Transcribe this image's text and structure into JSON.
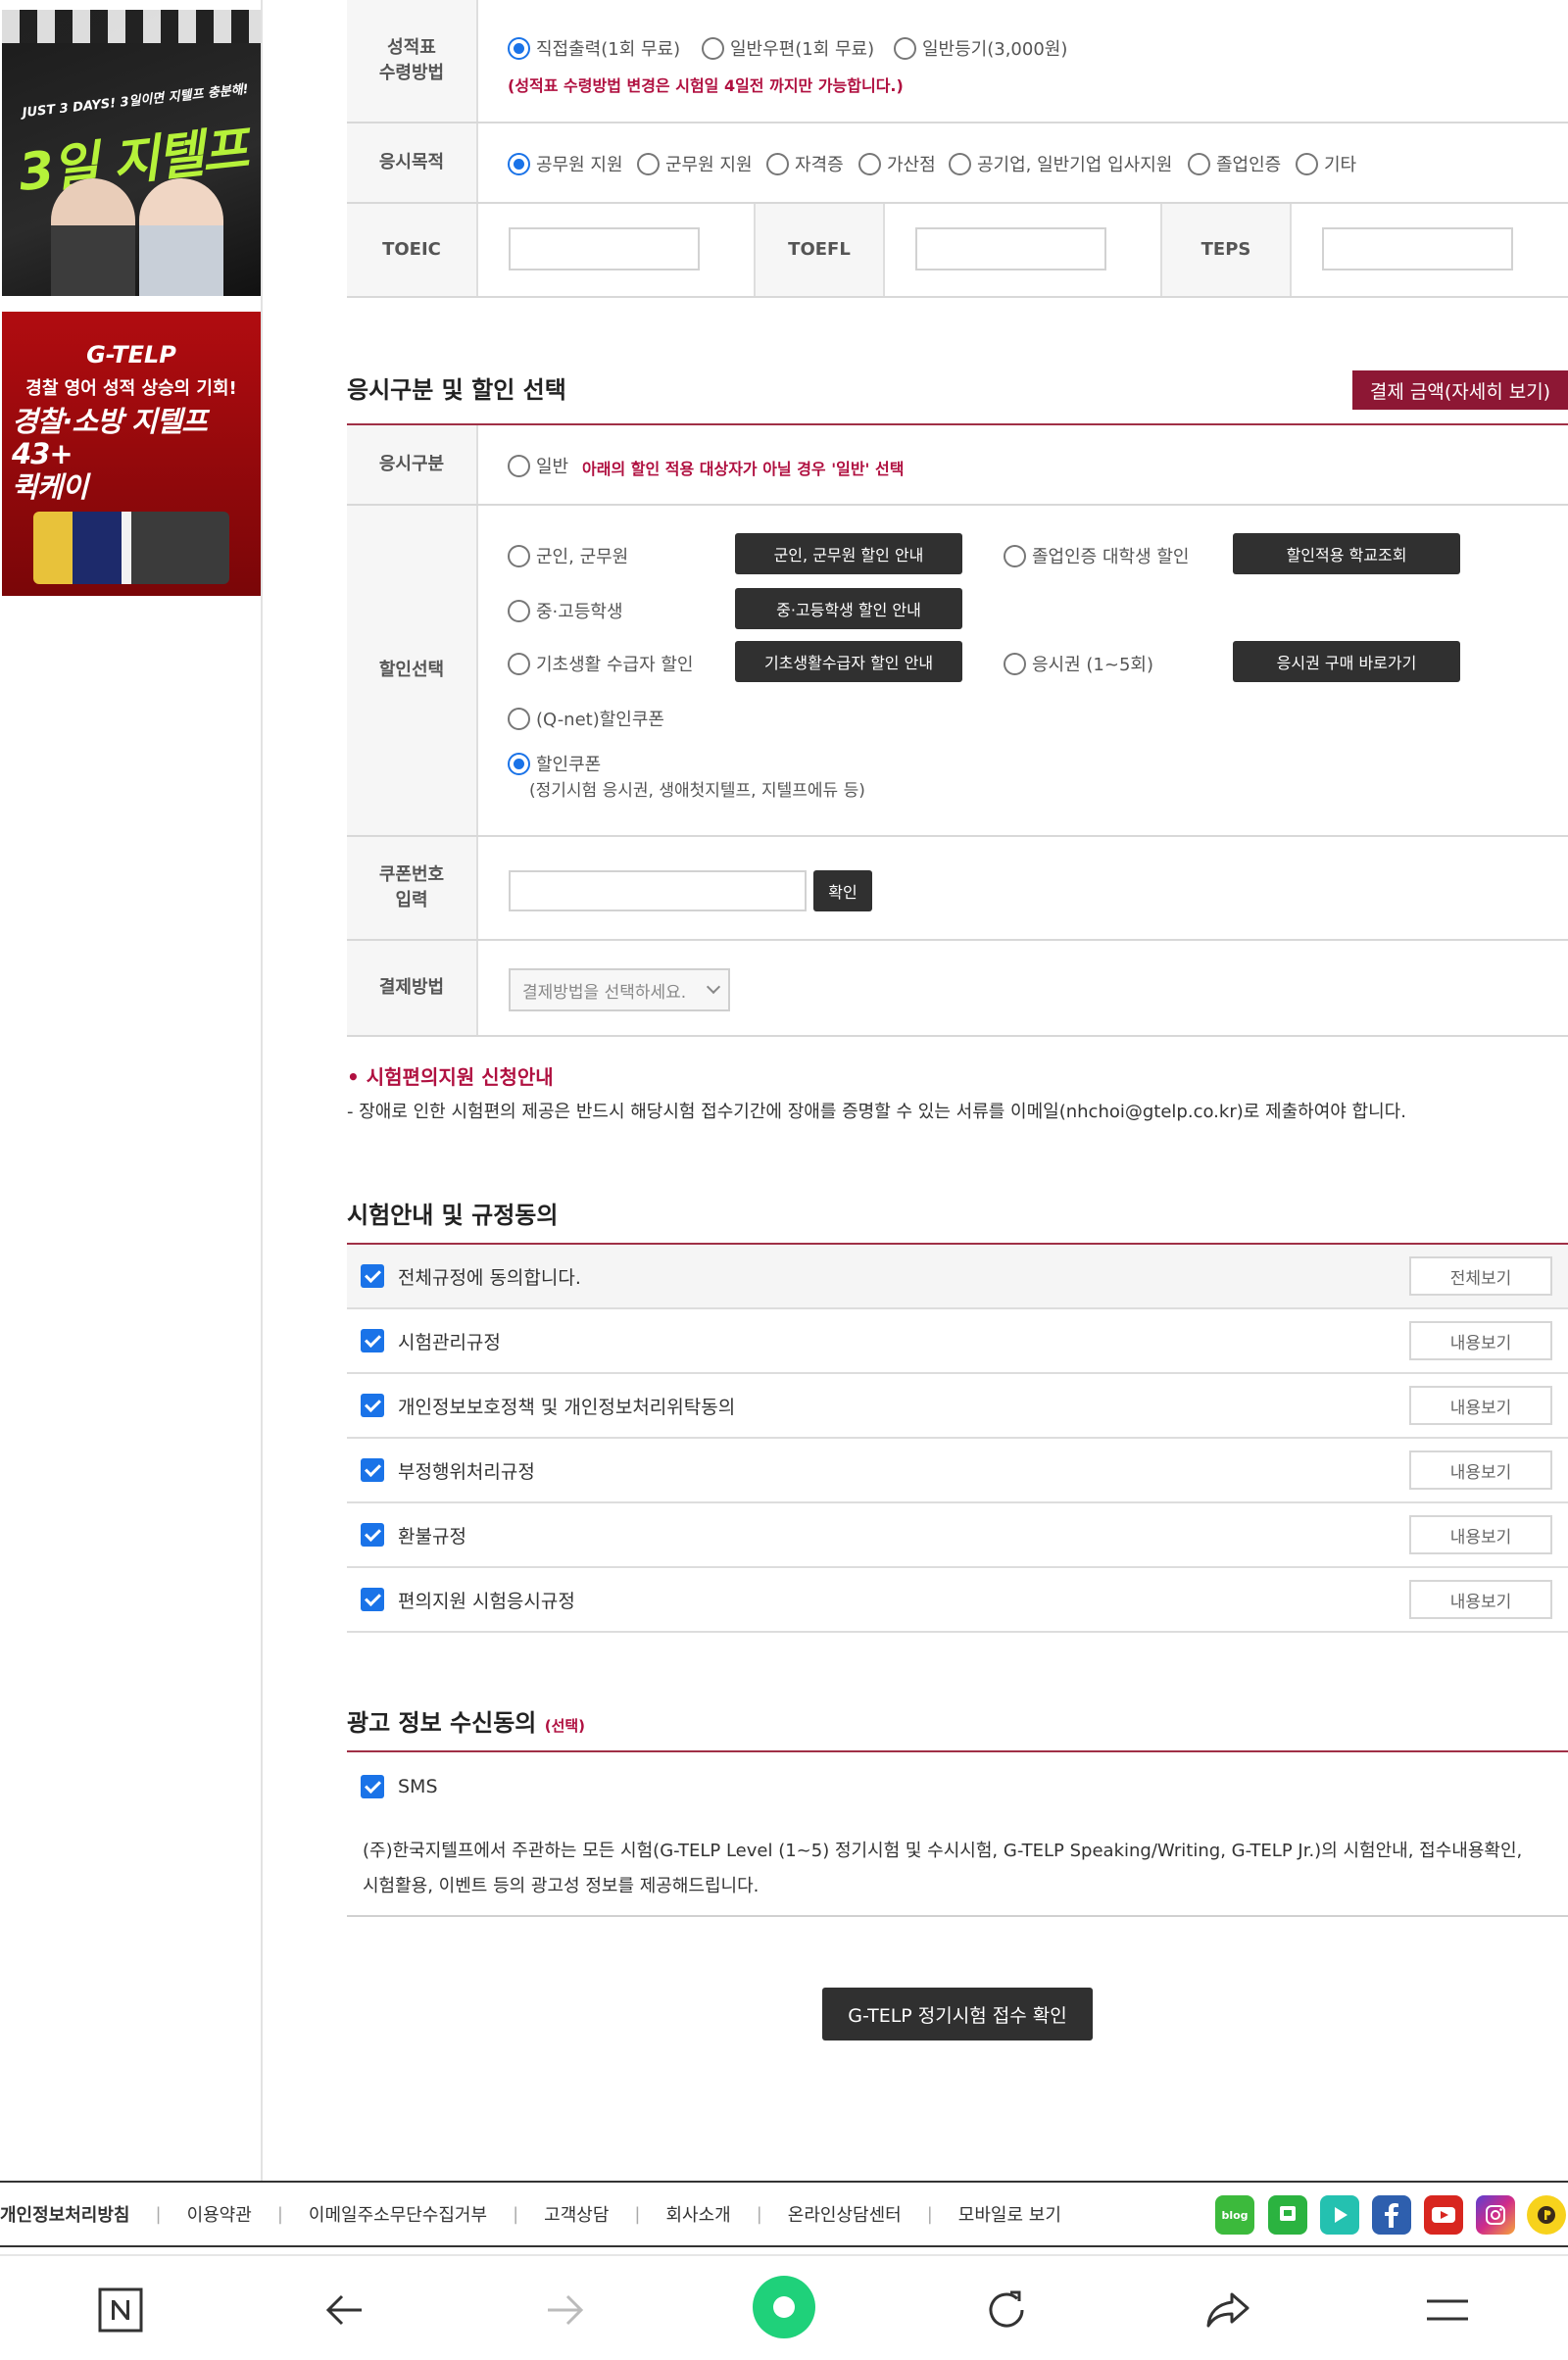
{
  "banners": {
    "b1_small": "JUST 3 DAYS! 3일이면 지텔프 충분해!",
    "b1_big": "3일 지텔프",
    "b2_logo": "G-TELP",
    "b2_sub": "경찰 영어 성적 상승의 기회!",
    "b2_big1": "경찰·소방 지텔프 43+",
    "b2_big2": "퀵케이"
  },
  "score_receipt": {
    "label_line1": "성적표",
    "label_line2": "수령방법",
    "options": [
      "직접출력(1회 무료)",
      "일반우편(1회 무료)",
      "일반등기(3,000원)"
    ],
    "selected": 0,
    "note": "(성적표 수령방법 변경은 시험일 4일전 까지만 가능합니다.)"
  },
  "purpose": {
    "label": "응시목적",
    "options": [
      "공무원 지원",
      "군무원 지원",
      "자격증",
      "가산점",
      "공기업, 일반기업 입사지원",
      "졸업인증",
      "기타"
    ],
    "selected": 0
  },
  "scores": {
    "toeic": "TOEIC",
    "toefl": "TOEFL",
    "teps": "TEPS"
  },
  "discount_section": {
    "title": "응시구분 및 할인 선택",
    "pay_button": "결제 금액(자세히 보기)",
    "type_label": "응시구분",
    "type_option": "일반",
    "type_note": "아래의 할인 적용 대상자가 아닐 경우 '일반' 선택",
    "discount_label": "할인선택",
    "opt_military": "군인, 군무원",
    "btn_military": "군인, 군무원 할인 안내",
    "opt_graduate": "졸업인증 대학생 할인",
    "btn_school": "할인적용 학교조회",
    "opt_student": "중·고등학생",
    "btn_student": "중·고등학생 할인 안내",
    "opt_welfare": "기초생활 수급자 할인",
    "btn_welfare": "기초생활수급자 할인 안내",
    "opt_voucher": "응시권 (1~5회)",
    "btn_voucher": "응시권 구매 바로가기",
    "opt_qnet": "(Q-net)할인쿠폰",
    "opt_coupon": "할인쿠폰",
    "coupon_desc": "(정기시험 응시권, 생애첫지텔프, 지텔프에듀 등)",
    "coupon_label_line1": "쿠폰번호",
    "coupon_label_line2": "입력",
    "confirm_btn": "확인",
    "pay_label": "결제방법",
    "pay_select": "결제방법을 선택하세요."
  },
  "convenience": {
    "title": "• 시험편의지원 신청안내",
    "text": "- 장애로 인한 시험편의 제공은 반드시 해당시험 접수기간에 장애를 증명할 수 있는 서류를 이메일(nhchoi@gtelp.co.kr)로 제출하여야 합니다."
  },
  "agreements": {
    "title": "시험안내 및 규정동의",
    "items": [
      {
        "label": "전체규정에 동의합니다.",
        "button": "전체보기"
      },
      {
        "label": "시험관리규정",
        "button": "내용보기"
      },
      {
        "label": "개인정보보호정책 및 개인정보처리위탁동의",
        "button": "내용보기"
      },
      {
        "label": "부정행위처리규정",
        "button": "내용보기"
      },
      {
        "label": "환불규정",
        "button": "내용보기"
      },
      {
        "label": "편의지원 시험응시규정",
        "button": "내용보기"
      }
    ]
  },
  "ads": {
    "title": "광고 정보 수신동의",
    "title_small": "(선택)",
    "sms": "SMS",
    "desc_line1": "(주)한국지텔프에서 주관하는 모든 시험(G-TELP Level (1~5) 정기시험 및 수시시험, G-TELP Speaking/Writing, G-TELP Jr.)의 시험안내, 접수내용확인,",
    "desc_line2": "시험활용, 이벤트 등의 광고성 정보를 제공해드립니다."
  },
  "submit_btn": "G-TELP 정기시험 접수 확인",
  "footer": {
    "links": [
      "개인정보처리방침",
      "이용약관",
      "이메일주소무단수집거부",
      "고객상담",
      "회사소개",
      "온라인상담센터",
      "모바일로 보기"
    ],
    "blog": "blog"
  },
  "icons": {
    "social": [
      "blog-icon",
      "naver-talk-icon",
      "play-icon",
      "facebook-icon",
      "youtube-icon",
      "instagram-icon",
      "kakao-icon"
    ],
    "nav": [
      "naver-n-icon",
      "back-arrow-icon",
      "forward-arrow-icon",
      "green-dot-icon",
      "refresh-icon",
      "share-icon",
      "menu-icon"
    ]
  },
  "colors": {
    "accent": "#8d1734",
    "check_blue": "#1a73e8",
    "note_red": "#b01040"
  }
}
